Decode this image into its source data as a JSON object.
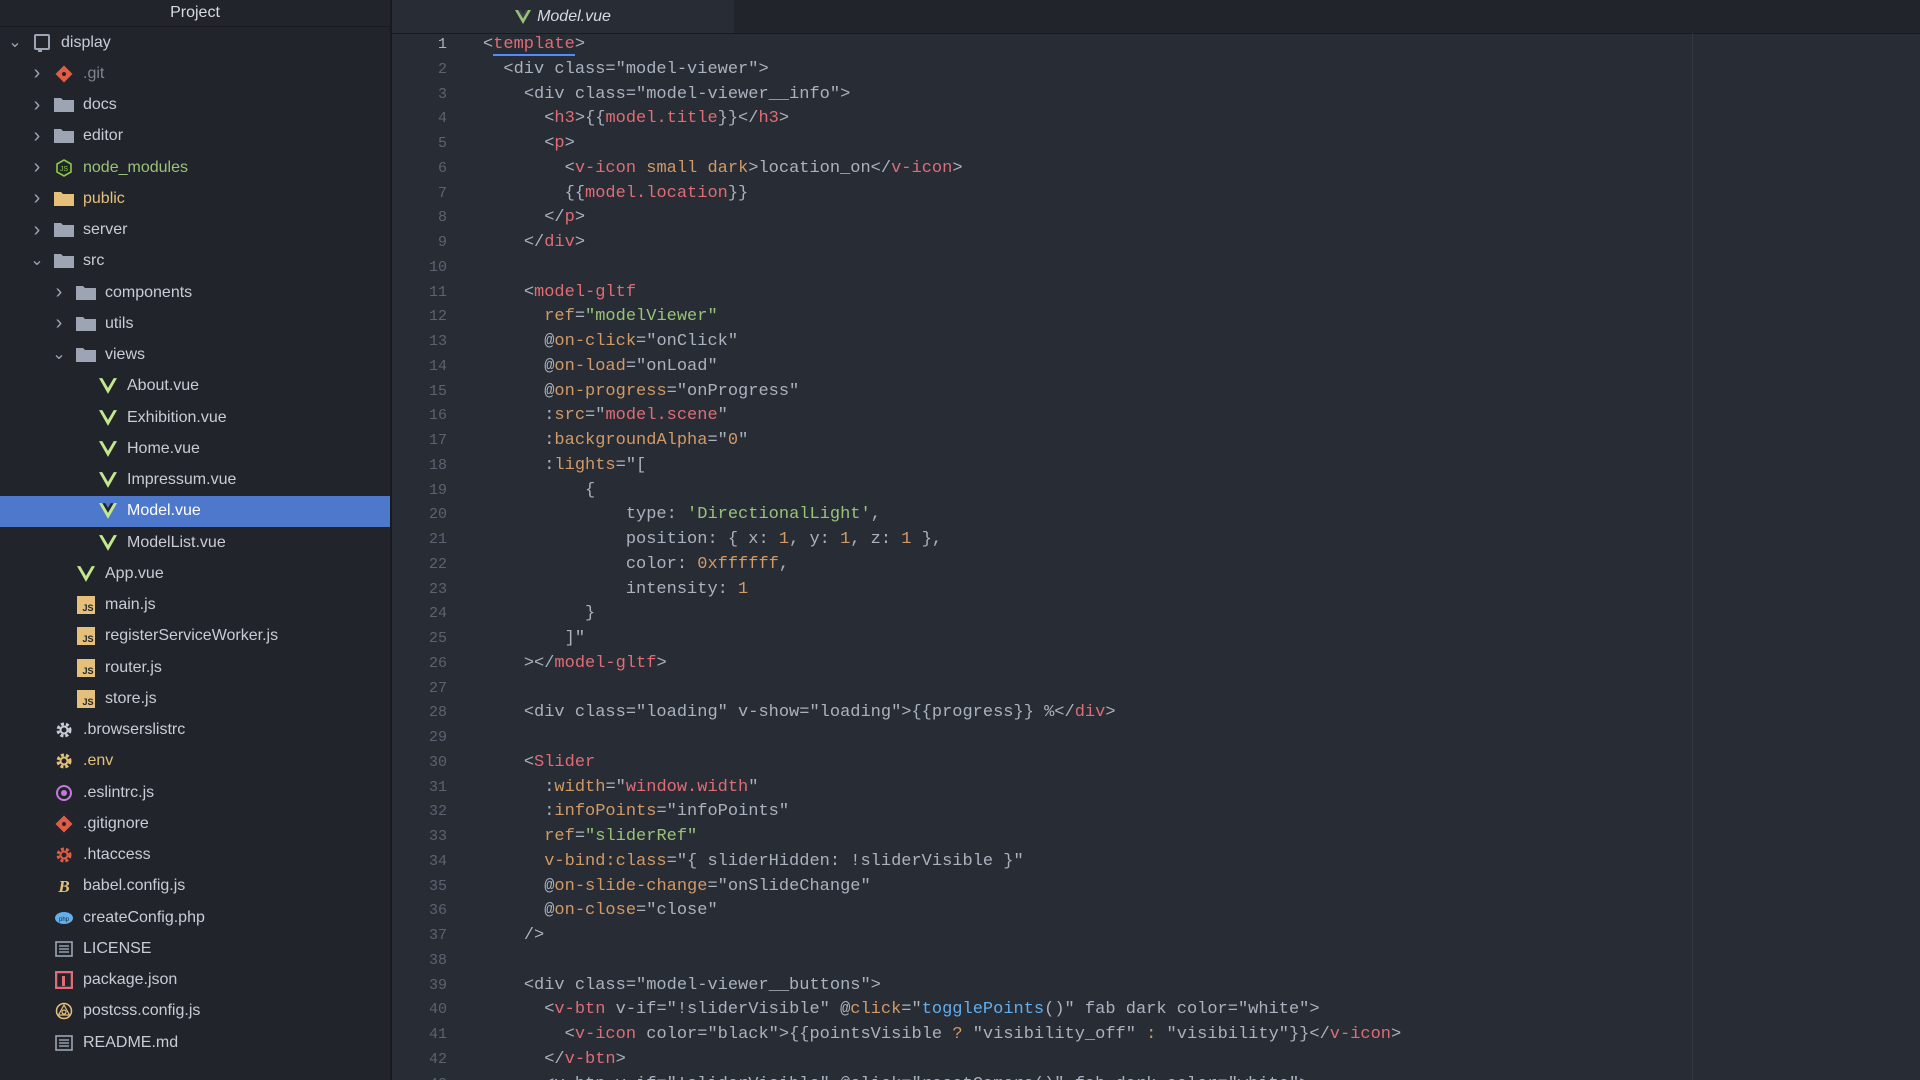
{
  "sidebar": {
    "title": "Project",
    "items": [
      {
        "label": "display",
        "depth": 0,
        "chevron": "open",
        "icon": "repo",
        "color": "normal",
        "name": "tree-item-display"
      },
      {
        "label": ".git",
        "depth": 1,
        "chevron": "closed",
        "icon": "git",
        "color": "gray",
        "name": "tree-item-git"
      },
      {
        "label": "docs",
        "depth": 1,
        "chevron": "closed",
        "icon": "folder",
        "color": "normal",
        "name": "tree-item-docs"
      },
      {
        "label": "editor",
        "depth": 1,
        "chevron": "closed",
        "icon": "folder",
        "color": "normal",
        "name": "tree-item-editor"
      },
      {
        "label": "node_modules",
        "depth": 1,
        "chevron": "closed",
        "icon": "node",
        "color": "green",
        "name": "tree-item-node-modules"
      },
      {
        "label": "public",
        "depth": 1,
        "chevron": "closed",
        "icon": "folder-yellow",
        "color": "yellow",
        "name": "tree-item-public"
      },
      {
        "label": "server",
        "depth": 1,
        "chevron": "closed",
        "icon": "folder",
        "color": "normal",
        "name": "tree-item-server"
      },
      {
        "label": "src",
        "depth": 1,
        "chevron": "open",
        "icon": "folder",
        "color": "normal",
        "name": "tree-item-src"
      },
      {
        "label": "components",
        "depth": 2,
        "chevron": "closed",
        "icon": "folder",
        "color": "normal",
        "name": "tree-item-components"
      },
      {
        "label": "utils",
        "depth": 2,
        "chevron": "closed",
        "icon": "folder",
        "color": "normal",
        "name": "tree-item-utils"
      },
      {
        "label": "views",
        "depth": 2,
        "chevron": "open",
        "icon": "folder",
        "color": "normal",
        "name": "tree-item-views"
      },
      {
        "label": "About.vue",
        "depth": 3,
        "chevron": "none",
        "icon": "vue",
        "color": "normal",
        "name": "tree-item-about-vue"
      },
      {
        "label": "Exhibition.vue",
        "depth": 3,
        "chevron": "none",
        "icon": "vue",
        "color": "normal",
        "name": "tree-item-exhibition-vue"
      },
      {
        "label": "Home.vue",
        "depth": 3,
        "chevron": "none",
        "icon": "vue",
        "color": "normal",
        "name": "tree-item-home-vue"
      },
      {
        "label": "Impressum.vue",
        "depth": 3,
        "chevron": "none",
        "icon": "vue",
        "color": "normal",
        "name": "tree-item-impressum-vue"
      },
      {
        "label": "Model.vue",
        "depth": 3,
        "chevron": "none",
        "icon": "vue",
        "color": "white",
        "selected": true,
        "name": "tree-item-model-vue"
      },
      {
        "label": "ModelList.vue",
        "depth": 3,
        "chevron": "none",
        "icon": "vue",
        "color": "normal",
        "name": "tree-item-modellist-vue"
      },
      {
        "label": "App.vue",
        "depth": 2,
        "chevron": "none",
        "icon": "vue",
        "color": "normal",
        "name": "tree-item-app-vue"
      },
      {
        "label": "main.js",
        "depth": 2,
        "chevron": "none",
        "icon": "js",
        "color": "normal",
        "name": "tree-item-main-js"
      },
      {
        "label": "registerServiceWorker.js",
        "depth": 2,
        "chevron": "none",
        "icon": "js",
        "color": "normal",
        "name": "tree-item-registerserviceworker-js"
      },
      {
        "label": "router.js",
        "depth": 2,
        "chevron": "none",
        "icon": "js",
        "color": "normal",
        "name": "tree-item-router-js"
      },
      {
        "label": "store.js",
        "depth": 2,
        "chevron": "none",
        "icon": "js",
        "color": "normal",
        "name": "tree-item-store-js"
      },
      {
        "label": ".browserslistrc",
        "depth": 1,
        "chevron": "none",
        "icon": "gear",
        "color": "normal",
        "name": "tree-item-browserslistrc"
      },
      {
        "label": ".env",
        "depth": 1,
        "chevron": "none",
        "icon": "gear-yellow",
        "color": "yellow",
        "name": "tree-item-env"
      },
      {
        "label": ".eslintrc.js",
        "depth": 1,
        "chevron": "none",
        "icon": "eslint",
        "color": "normal",
        "name": "tree-item-eslintrc"
      },
      {
        "label": ".gitignore",
        "depth": 1,
        "chevron": "none",
        "icon": "git",
        "color": "normal",
        "name": "tree-item-gitignore"
      },
      {
        "label": ".htaccess",
        "depth": 1,
        "chevron": "none",
        "icon": "gear-red",
        "color": "normal",
        "name": "tree-item-htaccess"
      },
      {
        "label": "babel.config.js",
        "depth": 1,
        "chevron": "none",
        "icon": "babel",
        "color": "normal",
        "name": "tree-item-babel-config"
      },
      {
        "label": "createConfig.php",
        "depth": 1,
        "chevron": "none",
        "icon": "php",
        "color": "normal",
        "name": "tree-item-createconfig-php"
      },
      {
        "label": "LICENSE",
        "depth": 1,
        "chevron": "none",
        "icon": "doc",
        "color": "normal",
        "name": "tree-item-license"
      },
      {
        "label": "package.json",
        "depth": 1,
        "chevron": "none",
        "icon": "npm",
        "color": "normal",
        "name": "tree-item-package-json"
      },
      {
        "label": "postcss.config.js",
        "depth": 1,
        "chevron": "none",
        "icon": "postcss",
        "color": "normal",
        "name": "tree-item-postcss-config"
      },
      {
        "label": "README.md",
        "depth": 1,
        "chevron": "none",
        "icon": "doc",
        "color": "normal",
        "name": "tree-item-readme"
      }
    ]
  },
  "editor": {
    "tab_label": "Model.vue",
    "tab_icon": "vue-icon",
    "current_line": 1,
    "lines": [
      {
        "n": "1",
        "indent": 0,
        "tokens": [
          [
            "p",
            "<"
          ],
          [
            "tag",
            "template"
          ],
          [
            "p",
            ">"
          ]
        ]
      },
      {
        "n": "2",
        "indent": 1,
        "tokens": [
          [
            "p",
            "<div class=\"model-viewer\">"
          ]
        ]
      },
      {
        "n": "3",
        "indent": 2,
        "tokens": [
          [
            "p",
            "<div class=\"model-viewer__info\">"
          ]
        ]
      },
      {
        "n": "4",
        "indent": 3,
        "tokens": [
          [
            "p",
            "<"
          ],
          [
            "tag",
            "h3"
          ],
          [
            "p",
            ">{{"
          ],
          [
            "tag",
            "model.title"
          ],
          [
            "p",
            "}}</"
          ],
          [
            "tag",
            "h3"
          ],
          [
            "p",
            ">"
          ]
        ]
      },
      {
        "n": "5",
        "indent": 3,
        "tokens": [
          [
            "p",
            "<"
          ],
          [
            "tag",
            "p"
          ],
          [
            "p",
            ">"
          ]
        ]
      },
      {
        "n": "6",
        "indent": 4,
        "tokens": [
          [
            "p",
            "<"
          ],
          [
            "tag",
            "v-icon"
          ],
          [
            "attr",
            " small dark"
          ],
          [
            "p",
            ">location_on</"
          ],
          [
            "tag",
            "v-icon"
          ],
          [
            "p",
            ">"
          ]
        ]
      },
      {
        "n": "7",
        "indent": 4,
        "tokens": [
          [
            "p",
            "{{"
          ],
          [
            "tag",
            "model.location"
          ],
          [
            "p",
            "}}"
          ]
        ]
      },
      {
        "n": "8",
        "indent": 3,
        "tokens": [
          [
            "p",
            "</"
          ],
          [
            "tag",
            "p"
          ],
          [
            "p",
            ">"
          ]
        ]
      },
      {
        "n": "9",
        "indent": 2,
        "tokens": [
          [
            "p",
            "</"
          ],
          [
            "tag",
            "div"
          ],
          [
            "p",
            ">"
          ]
        ]
      },
      {
        "n": "10",
        "indent": 1,
        "tokens": []
      },
      {
        "n": "11",
        "indent": 2,
        "tokens": [
          [
            "p",
            "<"
          ],
          [
            "tag",
            "model-gltf"
          ]
        ]
      },
      {
        "n": "12",
        "indent": 3,
        "tokens": [
          [
            "attr",
            "ref"
          ],
          [
            "p",
            "="
          ],
          [
            "str",
            "\"modelViewer\""
          ]
        ]
      },
      {
        "n": "13",
        "indent": 3,
        "tokens": [
          [
            "p",
            "@"
          ],
          [
            "attr",
            "on-click"
          ],
          [
            "p",
            "="
          ],
          [
            "p",
            "\"onClick\""
          ]
        ]
      },
      {
        "n": "14",
        "indent": 3,
        "tokens": [
          [
            "p",
            "@"
          ],
          [
            "attr",
            "on-load"
          ],
          [
            "p",
            "="
          ],
          [
            "p",
            "\"onLoad\""
          ]
        ]
      },
      {
        "n": "15",
        "indent": 3,
        "tokens": [
          [
            "p",
            "@"
          ],
          [
            "attr",
            "on-progress"
          ],
          [
            "p",
            "="
          ],
          [
            "p",
            "\"onProgress\""
          ]
        ]
      },
      {
        "n": "16",
        "indent": 3,
        "tokens": [
          [
            "p",
            ":"
          ],
          [
            "attr",
            "src"
          ],
          [
            "p",
            "=\""
          ],
          [
            "tag",
            "model.scene"
          ],
          [
            "p",
            "\""
          ]
        ]
      },
      {
        "n": "17",
        "indent": 3,
        "tokens": [
          [
            "p",
            ":"
          ],
          [
            "attr",
            "backgroundAlpha"
          ],
          [
            "p",
            "=\""
          ],
          [
            "num",
            "0"
          ],
          [
            "p",
            "\""
          ]
        ]
      },
      {
        "n": "18",
        "indent": 3,
        "tokens": [
          [
            "p",
            ":"
          ],
          [
            "attr",
            "lights"
          ],
          [
            "p",
            "=\"["
          ]
        ]
      },
      {
        "n": "19",
        "indent": 5,
        "tokens": [
          [
            "p",
            "{"
          ]
        ]
      },
      {
        "n": "20",
        "indent": 7,
        "tokens": [
          [
            "p",
            "type: "
          ],
          [
            "str",
            "'DirectionalLight'"
          ],
          [
            "p",
            ","
          ]
        ]
      },
      {
        "n": "21",
        "indent": 7,
        "tokens": [
          [
            "p",
            "position: { x: "
          ],
          [
            "num",
            "1"
          ],
          [
            "p",
            ", y: "
          ],
          [
            "num",
            "1"
          ],
          [
            "p",
            ", z: "
          ],
          [
            "num",
            "1"
          ],
          [
            "p",
            " },"
          ]
        ]
      },
      {
        "n": "22",
        "indent": 7,
        "tokens": [
          [
            "p",
            "color: "
          ],
          [
            "num",
            "0xffffff"
          ],
          [
            "p",
            ","
          ]
        ]
      },
      {
        "n": "23",
        "indent": 7,
        "tokens": [
          [
            "p",
            "intensity: "
          ],
          [
            "num",
            "1"
          ]
        ]
      },
      {
        "n": "24",
        "indent": 5,
        "tokens": [
          [
            "p",
            "}"
          ]
        ]
      },
      {
        "n": "25",
        "indent": 4,
        "tokens": [
          [
            "p",
            "]\""
          ]
        ]
      },
      {
        "n": "26",
        "indent": 2,
        "tokens": [
          [
            "p",
            "></"
          ],
          [
            "tag",
            "model-gltf"
          ],
          [
            "p",
            ">"
          ]
        ]
      },
      {
        "n": "27",
        "indent": 1,
        "tokens": []
      },
      {
        "n": "28",
        "indent": 2,
        "tokens": [
          [
            "p",
            "<div class=\"loading\" v-show=\"loading\">{{progress}} %</"
          ],
          [
            "tag",
            "div"
          ],
          [
            "p",
            ">"
          ]
        ]
      },
      {
        "n": "29",
        "indent": 1,
        "tokens": []
      },
      {
        "n": "30",
        "indent": 2,
        "tokens": [
          [
            "p",
            "<"
          ],
          [
            "tag",
            "Slider"
          ]
        ]
      },
      {
        "n": "31",
        "indent": 3,
        "tokens": [
          [
            "p",
            ":"
          ],
          [
            "attr",
            "width"
          ],
          [
            "p",
            "=\""
          ],
          [
            "tag",
            "window.width"
          ],
          [
            "p",
            "\""
          ]
        ]
      },
      {
        "n": "32",
        "indent": 3,
        "tokens": [
          [
            "p",
            ":"
          ],
          [
            "attr",
            "infoPoints"
          ],
          [
            "p",
            "=\"infoPoints\""
          ]
        ]
      },
      {
        "n": "33",
        "indent": 3,
        "tokens": [
          [
            "attr",
            "ref"
          ],
          [
            "p",
            "="
          ],
          [
            "str",
            "\"sliderRef\""
          ]
        ]
      },
      {
        "n": "34",
        "indent": 3,
        "tokens": [
          [
            "attr",
            "v-bind:class"
          ],
          [
            "p",
            "=\"{ sliderHidden: !sliderVisible }\""
          ]
        ]
      },
      {
        "n": "35",
        "indent": 3,
        "tokens": [
          [
            "p",
            "@"
          ],
          [
            "attr",
            "on-slide-change"
          ],
          [
            "p",
            "=\"onSlideChange\""
          ]
        ]
      },
      {
        "n": "36",
        "indent": 3,
        "tokens": [
          [
            "p",
            "@"
          ],
          [
            "attr",
            "on-close"
          ],
          [
            "p",
            "=\"close\""
          ]
        ]
      },
      {
        "n": "37",
        "indent": 2,
        "tokens": [
          [
            "p",
            "/>"
          ]
        ]
      },
      {
        "n": "38",
        "indent": 1,
        "tokens": []
      },
      {
        "n": "39",
        "indent": 2,
        "tokens": [
          [
            "p",
            "<div class=\"model-viewer__buttons\">"
          ]
        ]
      },
      {
        "n": "40",
        "indent": 3,
        "tokens": [
          [
            "p",
            "<"
          ],
          [
            "tag",
            "v-btn"
          ],
          [
            "p",
            " v-if=\"!sliderVisible\" @"
          ],
          [
            "attr",
            "click"
          ],
          [
            "p",
            "=\""
          ],
          [
            "fn",
            "togglePoints"
          ],
          [
            "p",
            "()\" fab dark color=\"white\">"
          ]
        ]
      },
      {
        "n": "41",
        "indent": 4,
        "tokens": [
          [
            "p",
            "<"
          ],
          [
            "tag",
            "v-icon"
          ],
          [
            "p",
            " color=\"black\">{{pointsVisible "
          ],
          [
            "attr",
            "?"
          ],
          [
            "p",
            " \"visibility_off\" "
          ],
          [
            "attr",
            ":"
          ],
          [
            "p",
            " \"visibility\"}}</"
          ],
          [
            "tag",
            "v-icon"
          ],
          [
            "p",
            ">"
          ]
        ]
      },
      {
        "n": "42",
        "indent": 3,
        "tokens": [
          [
            "p",
            "</"
          ],
          [
            "tag",
            "v-btn"
          ],
          [
            "p",
            ">"
          ]
        ]
      },
      {
        "n": "43",
        "indent": 3,
        "tokens": [
          [
            "p",
            "<v-btn v-if=\"!sliderVisible\" @click=\"resetCamera()\" fab dark color=\"white\">"
          ]
        ]
      }
    ]
  }
}
